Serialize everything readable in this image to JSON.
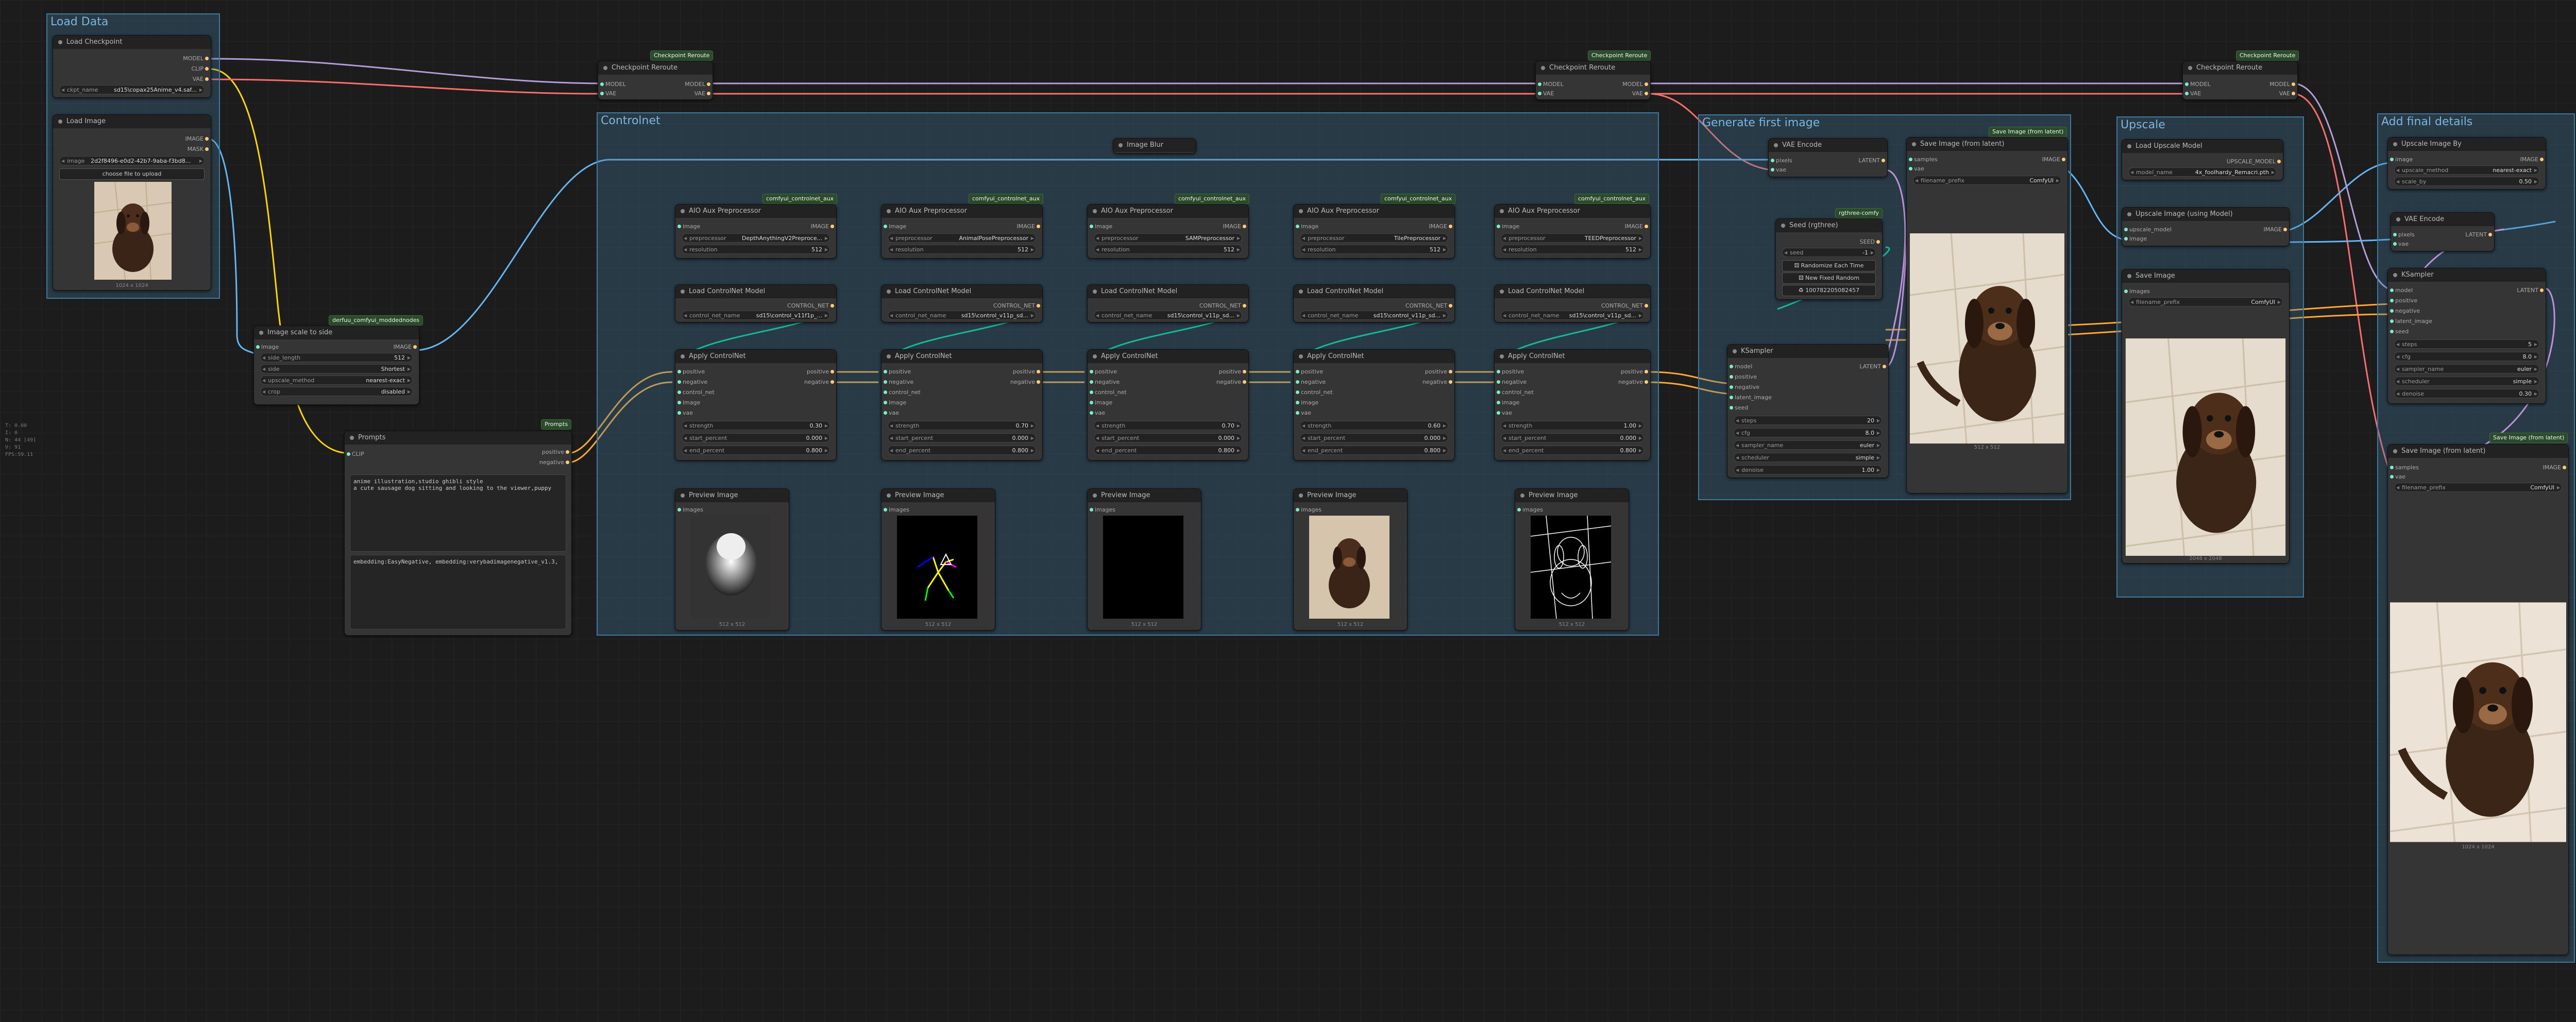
{
  "side_info": [
    "T: 0.00",
    "I: 0",
    "N: 44 [49]",
    "V: 91",
    "FPS:59.11"
  ],
  "groups": {
    "load_data": "Load Data",
    "controlnet": "Controlnet",
    "generate": "Generate first image",
    "upscale": "Upscale",
    "add_details": "Add final details"
  },
  "badges": {
    "checkpoint_reroute": "Checkpoint Reroute",
    "derfuu": "derfuu_comfyui_moddednodes",
    "prompts": "Prompts",
    "controlnet_aux": "comfyui_controlnet_aux",
    "rgthree": "rgthree-comfy",
    "save_from_latent": "Save Image (from latent)"
  },
  "load_checkpoint": {
    "title": "Load Checkpoint",
    "outputs": [
      "MODEL",
      "CLIP",
      "VAE"
    ],
    "ckpt_label": "ckpt_name",
    "ckpt_value": "sd15\\copax25Anime_v4.saf..."
  },
  "load_image": {
    "title": "Load Image",
    "outputs": [
      "IMAGE",
      "MASK"
    ],
    "image_label": "image",
    "image_value": "2d2f8496-e0d2-42b7-9aba-f3bd8...",
    "upload_label": "choose file to upload",
    "caption": "1024 x 1024"
  },
  "image_scale": {
    "title": "Image scale to side",
    "input": "image",
    "output": "IMAGE",
    "widgets": [
      {
        "label": "side_length",
        "value": "512"
      },
      {
        "label": "side",
        "value": "Shortest"
      },
      {
        "label": "upscale_method",
        "value": "nearest-exact"
      },
      {
        "label": "crop",
        "value": "disabled"
      }
    ]
  },
  "prompts": {
    "title": "Prompts",
    "input": "CLIP",
    "outputs": [
      "positive",
      "negative"
    ],
    "positive_text": "anime illustration,studio ghibli style\na cute sausage dog sitting and looking to the viewer,puppy",
    "negative_text": "embedding:EasyNegative, embedding:verybadimagenegative_v1.3,"
  },
  "reroute": {
    "title": "Checkpoint Reroute",
    "inputs": [
      "MODEL",
      "VAE"
    ],
    "outputs": [
      "MODEL",
      "VAE"
    ]
  },
  "image_blur": {
    "title": "Image Blur"
  },
  "aux": [
    {
      "title": "AIO Aux Preprocessor",
      "input": "image",
      "output": "IMAGE",
      "pre_label": "preprocessor",
      "pre_value": "DepthAnythingV2Preproce...",
      "res_label": "resolution",
      "res_value": "512"
    },
    {
      "title": "AIO Aux Preprocessor",
      "input": "image",
      "output": "IMAGE",
      "pre_label": "preprocessor",
      "pre_value": "AnimalPosePreprocessor",
      "res_label": "resolution",
      "res_value": "512"
    },
    {
      "title": "AIO Aux Preprocessor",
      "input": "image",
      "output": "IMAGE",
      "pre_label": "preprocessor",
      "pre_value": "SAMPreprocessor",
      "res_label": "resolution",
      "res_value": "512"
    },
    {
      "title": "AIO Aux Preprocessor",
      "input": "image",
      "output": "IMAGE",
      "pre_label": "preprocessor",
      "pre_value": "TilePreprocessor",
      "res_label": "resolution",
      "res_value": "512"
    },
    {
      "title": "AIO Aux Preprocessor",
      "input": "image",
      "output": "IMAGE",
      "pre_label": "preprocessor",
      "pre_value": "TEEDPreprocessor",
      "res_label": "resolution",
      "res_value": "512"
    }
  ],
  "cn_loaders": [
    {
      "title": "Load ControlNet Model",
      "output": "CONTROL_NET",
      "label": "control_net_name",
      "value": "sd15\\control_v11f1p_..."
    },
    {
      "title": "Load ControlNet Model",
      "output": "CONTROL_NET",
      "label": "control_net_name",
      "value": "sd15\\control_v11p_sd..."
    },
    {
      "title": "Load ControlNet Model",
      "output": "CONTROL_NET",
      "label": "control_net_name",
      "value": "sd15\\control_v11p_sd..."
    },
    {
      "title": "Load ControlNet Model",
      "output": "CONTROL_NET",
      "label": "control_net_name",
      "value": "sd15\\control_v11p_sd..."
    },
    {
      "title": "Load ControlNet Model",
      "output": "CONTROL_NET",
      "label": "control_net_name",
      "value": "sd15\\control_v11p_sd..."
    }
  ],
  "apply_cn": [
    {
      "title": "Apply ControlNet",
      "inputs": [
        "positive",
        "negative",
        "control_net",
        "image",
        "vae"
      ],
      "outputs": [
        "positive",
        "negative"
      ],
      "strength": "0.30",
      "start": "0.000",
      "end": "0.800"
    },
    {
      "title": "Apply ControlNet",
      "inputs": [
        "positive",
        "negative",
        "control_net",
        "image",
        "vae"
      ],
      "outputs": [
        "positive",
        "negative"
      ],
      "strength": "0.70",
      "start": "0.000",
      "end": "0.800"
    },
    {
      "title": "Apply ControlNet",
      "inputs": [
        "positive",
        "negative",
        "control_net",
        "image",
        "vae"
      ],
      "outputs": [
        "positive",
        "negative"
      ],
      "strength": "0.70",
      "start": "0.000",
      "end": "0.800"
    },
    {
      "title": "Apply ControlNet",
      "inputs": [
        "positive",
        "negative",
        "control_net",
        "image",
        "vae"
      ],
      "outputs": [
        "positive",
        "negative"
      ],
      "strength": "0.60",
      "start": "0.000",
      "end": "0.800"
    },
    {
      "title": "Apply ControlNet",
      "inputs": [
        "positive",
        "negative",
        "control_net",
        "image",
        "vae"
      ],
      "outputs": [
        "positive",
        "negative"
      ],
      "strength": "1.00",
      "start": "0.000",
      "end": "0.800"
    }
  ],
  "apply_labels": {
    "strength": "strength",
    "start": "start_percent",
    "end": "end_percent"
  },
  "previews": [
    {
      "title": "Preview Image",
      "input": "images",
      "caption": "512 x 512"
    },
    {
      "title": "Preview Image",
      "input": "images",
      "caption": "512 x 512"
    },
    {
      "title": "Preview Image",
      "input": "images",
      "caption": "512 x 512"
    },
    {
      "title": "Preview Image",
      "input": "images",
      "caption": "512 x 512"
    },
    {
      "title": "Preview Image",
      "input": "images",
      "caption": "512 x 512"
    }
  ],
  "vae_encode_1": {
    "title": "VAE Encode",
    "inputs": [
      "pixels",
      "vae"
    ],
    "output": "LATENT"
  },
  "seed": {
    "title": "Seed (rgthree)",
    "output": "SEED",
    "seed_label": "seed",
    "seed_value": "-1",
    "btn_random": "Randomize Each Time",
    "btn_new": "New Fixed Random",
    "btn_last": "100782205082457"
  },
  "ksampler_1": {
    "title": "KSampler",
    "inputs": [
      "model",
      "positive",
      "negative",
      "latent_image",
      "seed"
    ],
    "output": "LATENT",
    "widgets": [
      {
        "label": "steps",
        "value": "20"
      },
      {
        "label": "cfg",
        "value": "8.0"
      },
      {
        "label": "sampler_name",
        "value": "euler"
      },
      {
        "label": "scheduler",
        "value": "simple"
      },
      {
        "label": "denoise",
        "value": "1.00"
      }
    ]
  },
  "save_latent_1": {
    "title": "Save Image (from latent)",
    "inputs": [
      "samples",
      "vae"
    ],
    "output": "IMAGE",
    "prefix_label": "filename_prefix",
    "prefix_value": "ComfyUI",
    "caption": "512 x 512"
  },
  "load_upscale": {
    "title": "Load Upscale Model",
    "output": "UPSCALE_MODEL",
    "label": "model_name",
    "value": "4x_foolhardy_Remacri.pth"
  },
  "upscale_with_model": {
    "title": "Upscale Image (using Model)",
    "inputs": [
      "upscale_model",
      "image"
    ],
    "output": "IMAGE"
  },
  "save_image": {
    "title": "Save Image",
    "input": "images",
    "prefix_label": "filename_prefix",
    "prefix_value": "ComfyUI",
    "caption": "2048 x 2048"
  },
  "upscale_by": {
    "title": "Upscale Image By",
    "input": "image",
    "output": "IMAGE",
    "widgets": [
      {
        "label": "upscale_method",
        "value": "nearest-exact"
      },
      {
        "label": "scale_by",
        "value": "0.50"
      }
    ]
  },
  "vae_encode_2": {
    "title": "VAE Encode",
    "inputs": [
      "pixels",
      "vae"
    ],
    "output": "LATENT"
  },
  "ksampler_2": {
    "title": "KSampler",
    "inputs": [
      "model",
      "positive",
      "negative",
      "latent_image",
      "seed"
    ],
    "output": "LATENT",
    "widgets": [
      {
        "label": "steps",
        "value": "5"
      },
      {
        "label": "cfg",
        "value": "8.0"
      },
      {
        "label": "sampler_name",
        "value": "euler"
      },
      {
        "label": "scheduler",
        "value": "simple"
      },
      {
        "label": "denoise",
        "value": "0.30"
      }
    ]
  },
  "save_latent_2": {
    "title": "Save Image (from latent)",
    "inputs": [
      "samples",
      "vae"
    ],
    "output": "IMAGE",
    "prefix_label": "filename_prefix",
    "prefix_value": "ComfyUI",
    "caption": "1024 x 1024"
  },
  "colors": {
    "canvas": "#1c1c1c",
    "group": "#3f789e",
    "wire_model": "#b39ddb",
    "wire_clip": "#ffd500",
    "wire_vae": "#ff6e6e",
    "wire_image": "#64b5f6",
    "wire_conditioning": "#ffa931",
    "wire_controlnet": "#00d78d",
    "wire_latent": "#ff9cf9"
  }
}
